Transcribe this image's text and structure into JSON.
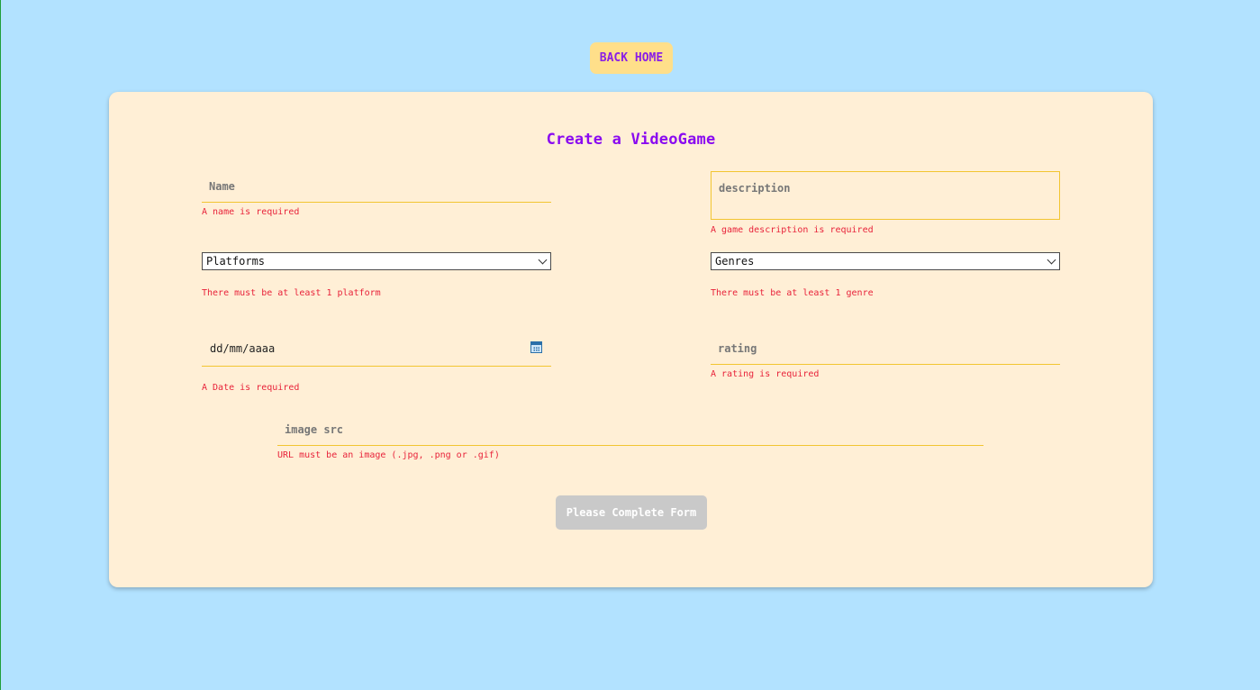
{
  "nav": {
    "back_label": "BACK HOME"
  },
  "form": {
    "title": "Create a VideoGame",
    "name": {
      "placeholder": "Name",
      "value": "",
      "error": "A name is required"
    },
    "description": {
      "placeholder": "description",
      "value": "",
      "error": "A game description is required"
    },
    "platforms": {
      "selected": "Platforms",
      "error": "There must be at least 1 platform"
    },
    "genres": {
      "selected": "Genres",
      "error": "There must be at least 1 genre"
    },
    "date": {
      "placeholder": "dd/mm/aaaa",
      "error": "A Date is required"
    },
    "rating": {
      "placeholder": "rating",
      "value": "",
      "error": "A rating is required"
    },
    "image": {
      "placeholder": "image src",
      "value": "",
      "error": "URL must be an image (.jpg, .png or .gif)"
    },
    "submit_label": "Please Complete Form"
  },
  "colors": {
    "background": "#b2e2ff",
    "card": "#ffefd6",
    "accent": "#8a0af0",
    "error": "#e8233a",
    "input_border": "#f2c531",
    "back_button": "#ffdf8a",
    "disabled_button": "#c9c9c9"
  },
  "icons": {
    "date_picker": "calendar-icon",
    "select_arrow": "chevron-down-icon"
  }
}
